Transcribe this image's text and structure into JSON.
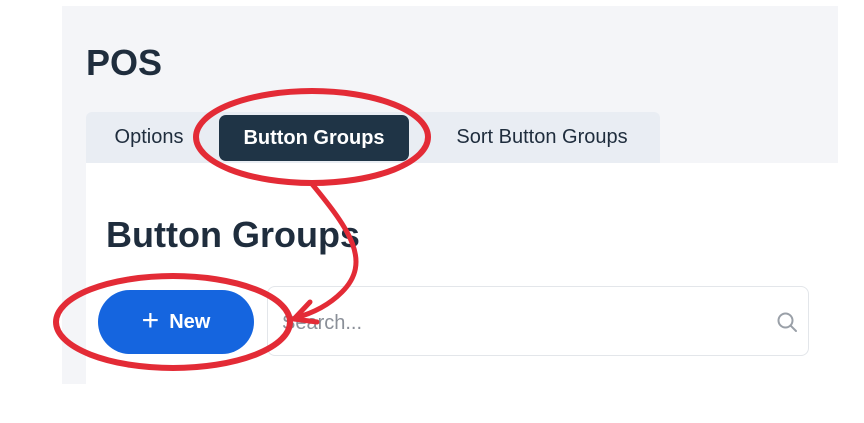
{
  "header": {
    "title": "POS"
  },
  "tabs": [
    {
      "label": "Options",
      "active": false
    },
    {
      "label": "Button Groups",
      "active": true
    },
    {
      "label": "Sort Button Groups",
      "active": false
    }
  ],
  "main": {
    "section_title": "Button Groups",
    "new_button": {
      "icon": "plus-icon",
      "label": "New"
    },
    "search": {
      "placeholder": "Search...",
      "value": "",
      "icon": "search-icon"
    }
  },
  "colors": {
    "active_tab": "#1f3446",
    "primary_button": "#1565df",
    "annotation": "#e32b36"
  }
}
